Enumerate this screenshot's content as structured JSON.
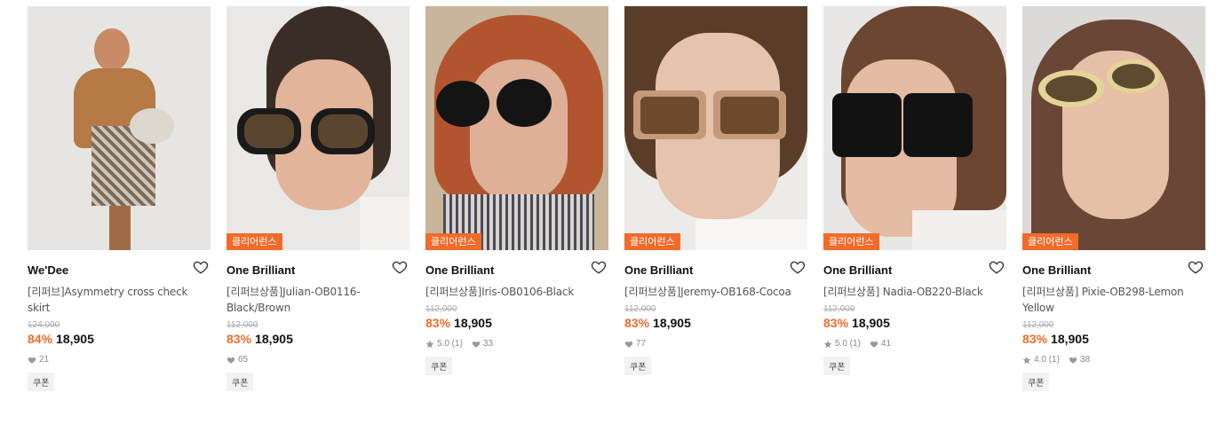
{
  "clear_badge_label": "클리어런스",
  "coupon_label": "쿠폰",
  "colors": {
    "accent": "#f26b2a"
  },
  "products": [
    {
      "brand": "We'Dee",
      "name": "[리퍼브]Asymmetry cross check skirt",
      "original_price": "124,000",
      "discount": "84%",
      "price": "18,905",
      "rating": "",
      "likes": "21",
      "clearance": false
    },
    {
      "brand": "One Brilliant",
      "name": "[리퍼브상품]Julian-OB0116-Black/Brown",
      "original_price": "112,000",
      "discount": "83%",
      "price": "18,905",
      "rating": "",
      "likes": "65",
      "clearance": true
    },
    {
      "brand": "One Brilliant",
      "name": "[리퍼브상품]Iris-OB0106-Black",
      "original_price": "112,000",
      "discount": "83%",
      "price": "18,905",
      "rating": "5.0 (1)",
      "likes": "33",
      "clearance": true
    },
    {
      "brand": "One Brilliant",
      "name": "[리퍼브상품]Jeremy-OB168-Cocoa",
      "original_price": "112,000",
      "discount": "83%",
      "price": "18,905",
      "rating": "",
      "likes": "77",
      "clearance": true
    },
    {
      "brand": "One Brilliant",
      "name": "[리퍼브상품] Nadia-OB220-Black",
      "original_price": "112,000",
      "discount": "83%",
      "price": "18,905",
      "rating": "5.0 (1)",
      "likes": "41",
      "clearance": true
    },
    {
      "brand": "One Brilliant",
      "name": "[리퍼브상품] Pixie-OB298-Lemon Yellow",
      "original_price": "112,000",
      "discount": "83%",
      "price": "18,905",
      "rating": "4.0 (1)",
      "likes": "38",
      "clearance": true
    }
  ]
}
